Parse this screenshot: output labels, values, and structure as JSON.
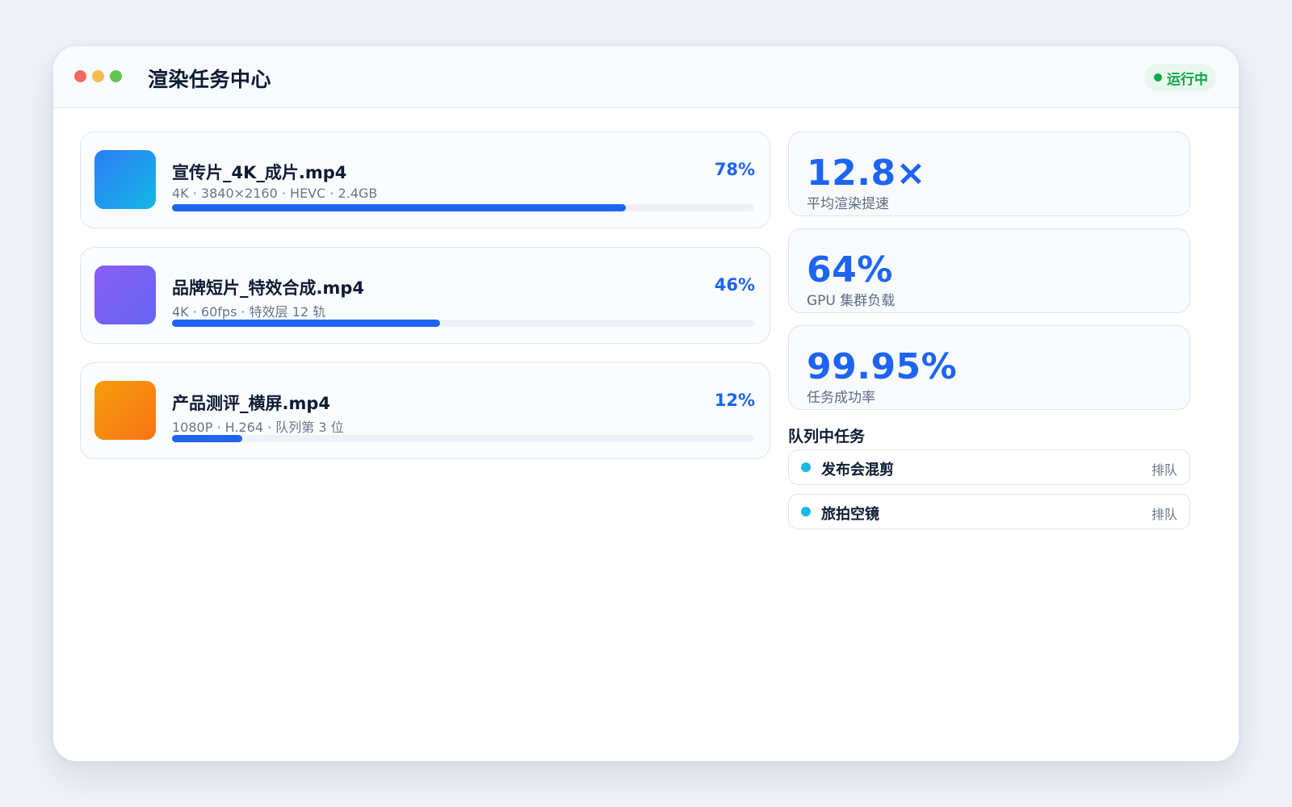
{
  "window": {
    "title": "渲染任务中心",
    "status": {
      "label": "运行中",
      "color": "#16a34a",
      "bg": "#e8f7ee"
    },
    "controls": [
      {
        "name": "close",
        "color": "#ee6a5f"
      },
      {
        "name": "minimize",
        "color": "#f5bd4f"
      },
      {
        "name": "maximize",
        "color": "#61c454"
      }
    ]
  },
  "tasks": [
    {
      "name": "宣传片_4K_成片.mp4",
      "meta": "4K · 3840×2160 · HEVC · 2.4GB",
      "progress_percent": 78,
      "progress_label": "78%",
      "thumb_gradient": [
        "#2c7cf6",
        "#14b8e6"
      ]
    },
    {
      "name": "品牌短片_特效合成.mp4",
      "meta": "4K · 60fps · 特效层 12 轨",
      "progress_percent": 46,
      "progress_label": "46%",
      "thumb_gradient": [
        "#8b5cf6",
        "#6366f1"
      ]
    },
    {
      "name": "产品测评_横屏.mp4",
      "meta": "1080P · H.264 · 队列第 3 位",
      "progress_percent": 12,
      "progress_label": "12%",
      "thumb_gradient": [
        "#f59e0b",
        "#f97316"
      ]
    }
  ],
  "stats": [
    {
      "value": "12.8×",
      "label": "平均渲染提速"
    },
    {
      "value": "64%",
      "label": "GPU 集群负载"
    },
    {
      "value": "99.95%",
      "label": "任务成功率"
    }
  ],
  "queue": {
    "title": "队列中任务",
    "items": [
      {
        "name": "发布会混剪",
        "status": "排队"
      },
      {
        "name": "旅拍空镜",
        "status": "排队"
      }
    ]
  },
  "colors": {
    "accent": "#1d64f2",
    "progress_fill": "#1d64f2",
    "queue_dot": "#1cb8e6"
  }
}
